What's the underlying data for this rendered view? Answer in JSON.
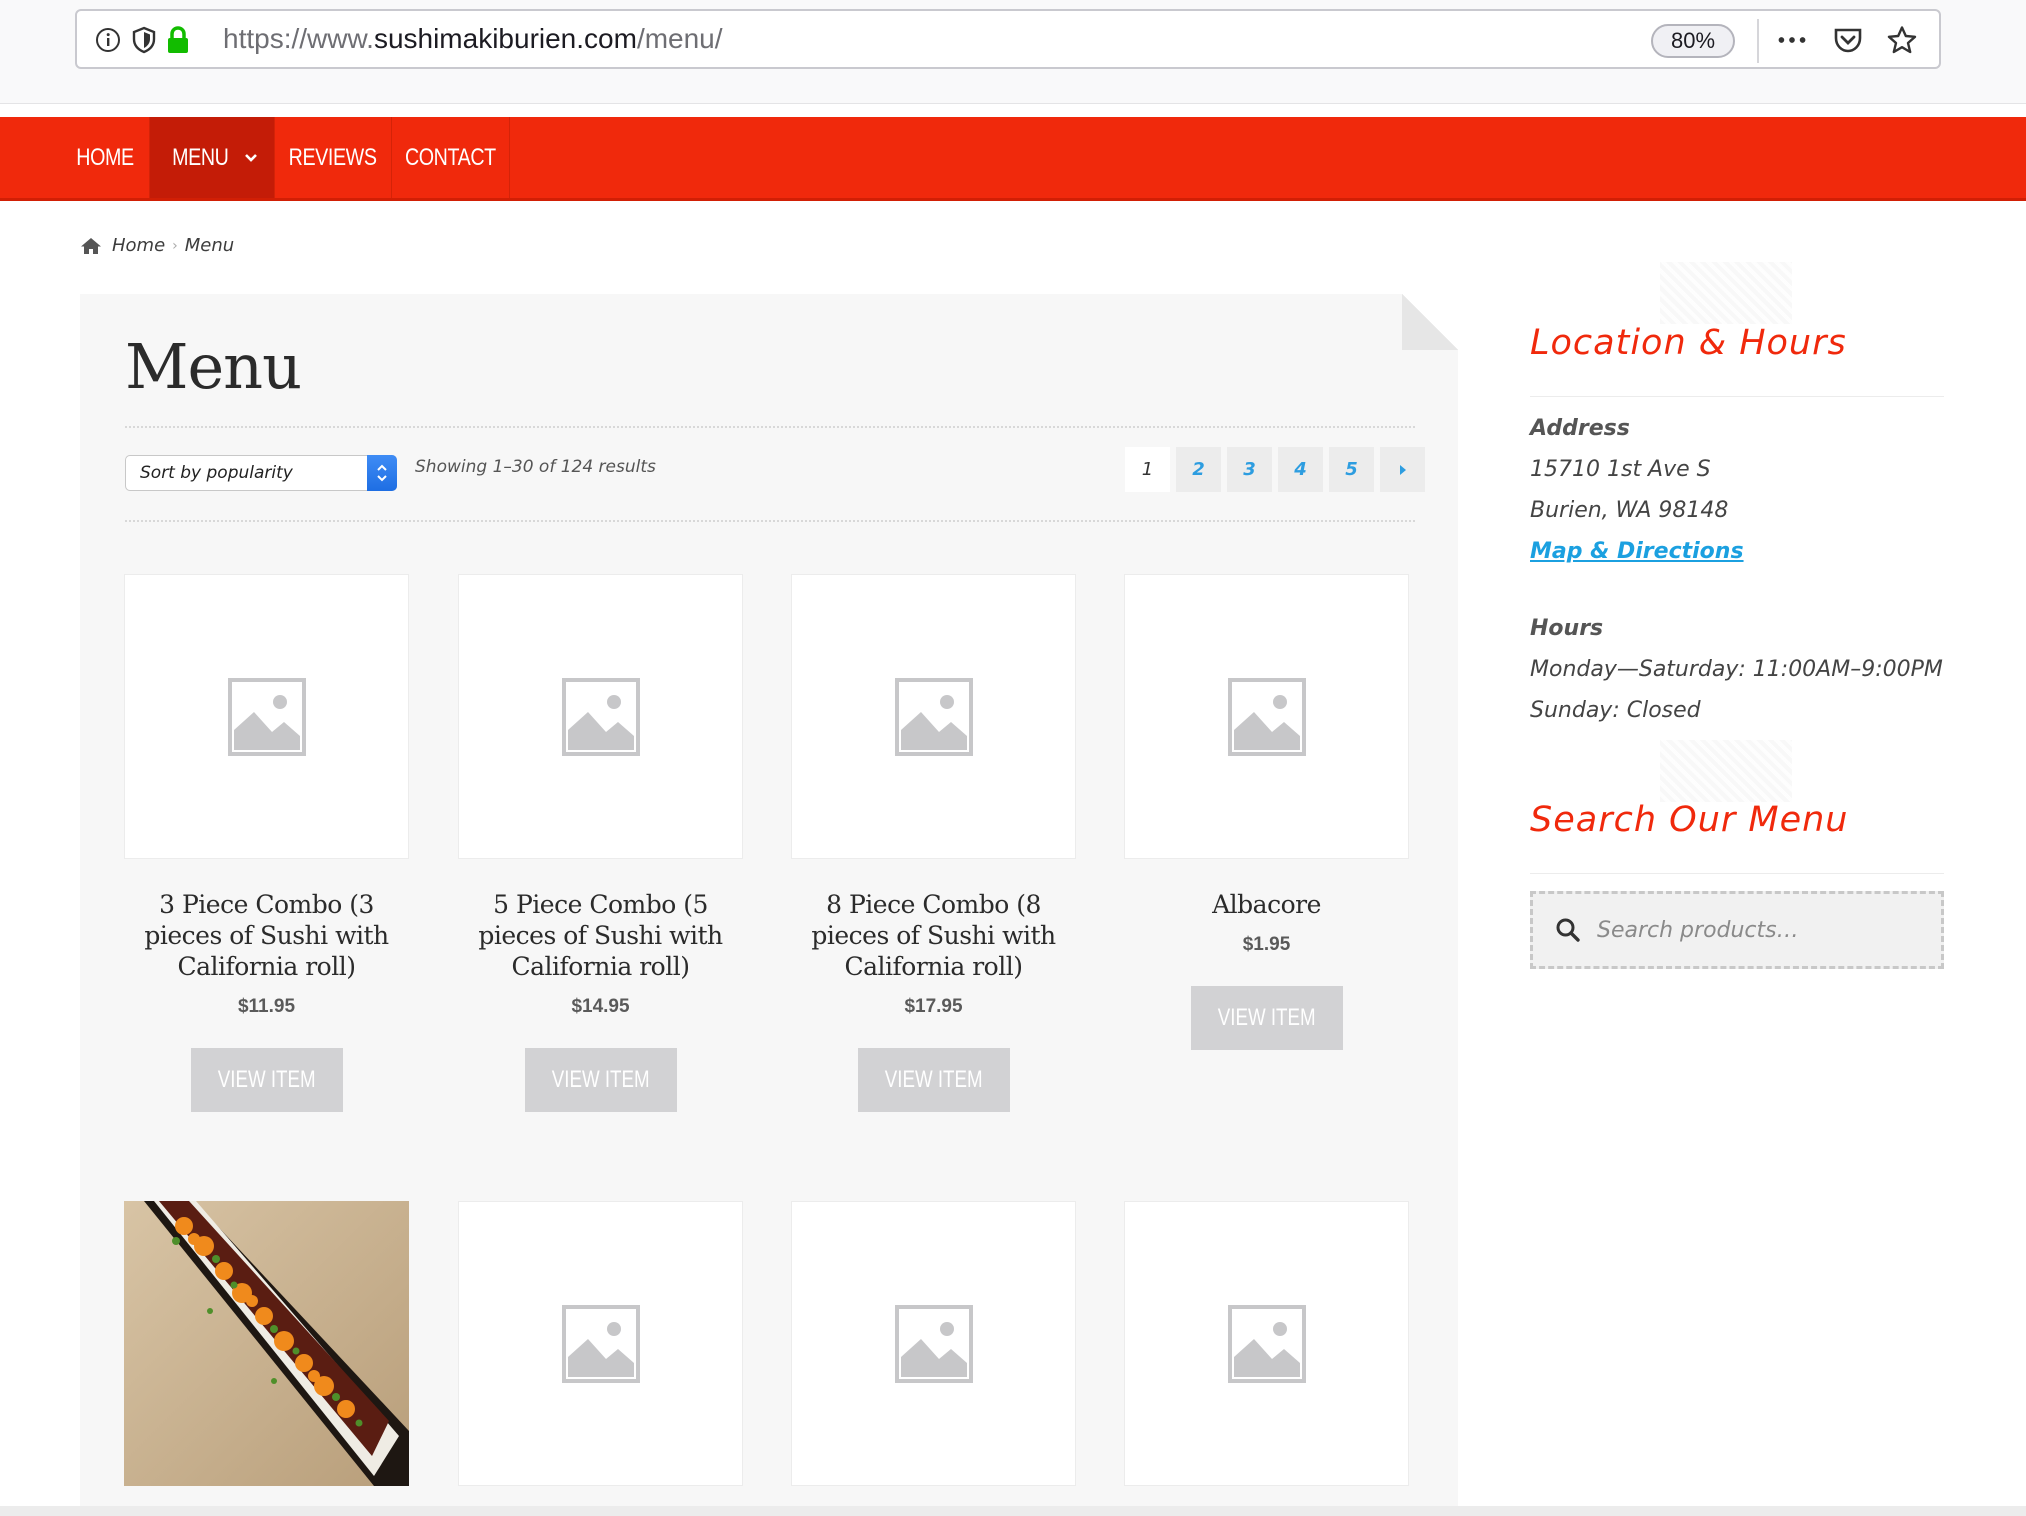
{
  "browser": {
    "url_prefix": "https://www.",
    "url_domain": "sushimakiburien.com",
    "url_path": "/menu/",
    "zoom": "80%"
  },
  "nav": {
    "items": [
      {
        "label": "HOME"
      },
      {
        "label": "MENU"
      },
      {
        "label": "REVIEWS"
      },
      {
        "label": "CONTACT"
      }
    ]
  },
  "breadcrumb": {
    "home": "Home",
    "current": "Menu"
  },
  "main": {
    "title": "Menu",
    "sort_label": "Sort by popularity",
    "showing": "Showing 1–30 of 124 results",
    "pages": [
      "1",
      "2",
      "3",
      "4",
      "5"
    ],
    "products": [
      {
        "name": "3 Piece Combo (3 pieces of Sushi with California roll)",
        "price": "$11.95",
        "button": "VIEW ITEM"
      },
      {
        "name": "5 Piece Combo (5 pieces of Sushi with California roll)",
        "price": "$14.95",
        "button": "VIEW ITEM"
      },
      {
        "name": "8 Piece Combo (8 pieces of Sushi with California roll)",
        "price": "$17.95",
        "button": "VIEW ITEM"
      },
      {
        "name": "Albacore",
        "price": "$1.95",
        "button": "VIEW ITEM"
      }
    ]
  },
  "sidebar": {
    "location_heading": "Location & Hours",
    "address_label": "Address",
    "address_line1": "15710 1st Ave S",
    "address_line2": "Burien, WA 98148",
    "map_link": "Map & Directions",
    "hours_label": "Hours",
    "hours_line1": "Monday—Saturday: 11:00AM–9:00PM",
    "hours_line2": "Sunday: Closed",
    "search_heading": "Search Our Menu",
    "search_placeholder": "Search products…"
  },
  "colors": {
    "brand_red": "#f0290c",
    "link_blue": "#1ba0e0",
    "button_gray": "#d2d2d4"
  }
}
